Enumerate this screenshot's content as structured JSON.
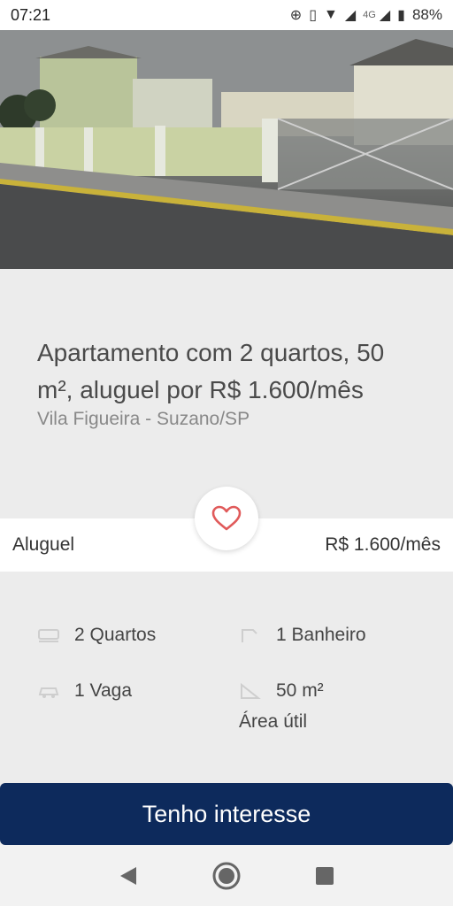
{
  "status_bar": {
    "time": "07:21",
    "network": "4G",
    "battery": "88%"
  },
  "listing": {
    "title": "Apartamento com 2 quartos, 50 m², aluguel por R$ 1.600/mês",
    "location": "Vila Figueira - Suzano/SP"
  },
  "price_row": {
    "label": "Aluguel",
    "value": "R$ 1.600/mês"
  },
  "features": {
    "bedrooms": "2 Quartos",
    "bathrooms": "1 Banheiro",
    "parking": "1 Vaga",
    "area": "50 m²",
    "area_label": "Área útil"
  },
  "cta": {
    "label": "Tenho interesse"
  },
  "colors": {
    "cta_background": "#0d2a5c",
    "heart": "#e05a5a"
  }
}
